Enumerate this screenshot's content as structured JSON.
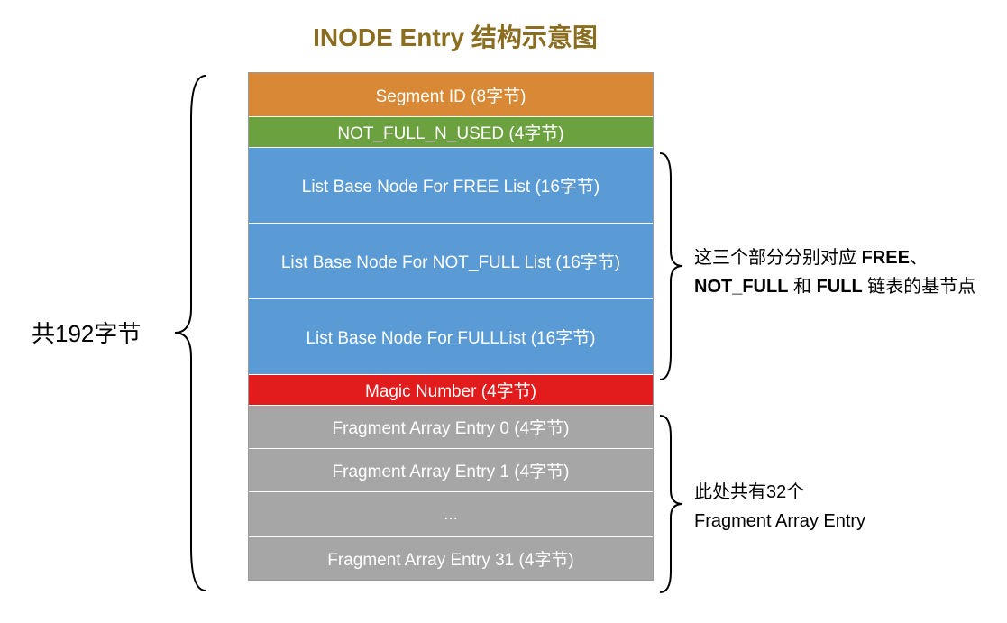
{
  "title": "INODE Entry 结构示意图",
  "leftLabel": "共192字节",
  "rows": {
    "segmentId": "Segment ID (8字节)",
    "notFullNUsed": "NOT_FULL_N_USED (4字节)",
    "freeList": "List Base Node For FREE List (16字节)",
    "notFullList": "List Base Node For NOT_FULL List (16字节)",
    "fullList": "List Base Node For FULLList (16字节)",
    "magicNumber": "Magic Number (4字节)",
    "fragEntry0": "Fragment Array Entry 0 (4字节)",
    "fragEntry1": "Fragment Array Entry 1 (4字节)",
    "ellipsis": "...",
    "fragEntry31": "Fragment Array Entry 31 (4字节)"
  },
  "annotations": {
    "top": {
      "prefix": "这三个部分分别对应 ",
      "bold1": "FREE",
      "sep1": "、",
      "bold2": "NOT_FULL",
      "sep2": " 和 ",
      "bold3": "FULL",
      "suffix": " 链表的基节点"
    },
    "bottom": {
      "line1": "此处共有32个",
      "line2": "Fragment Array Entry"
    }
  }
}
